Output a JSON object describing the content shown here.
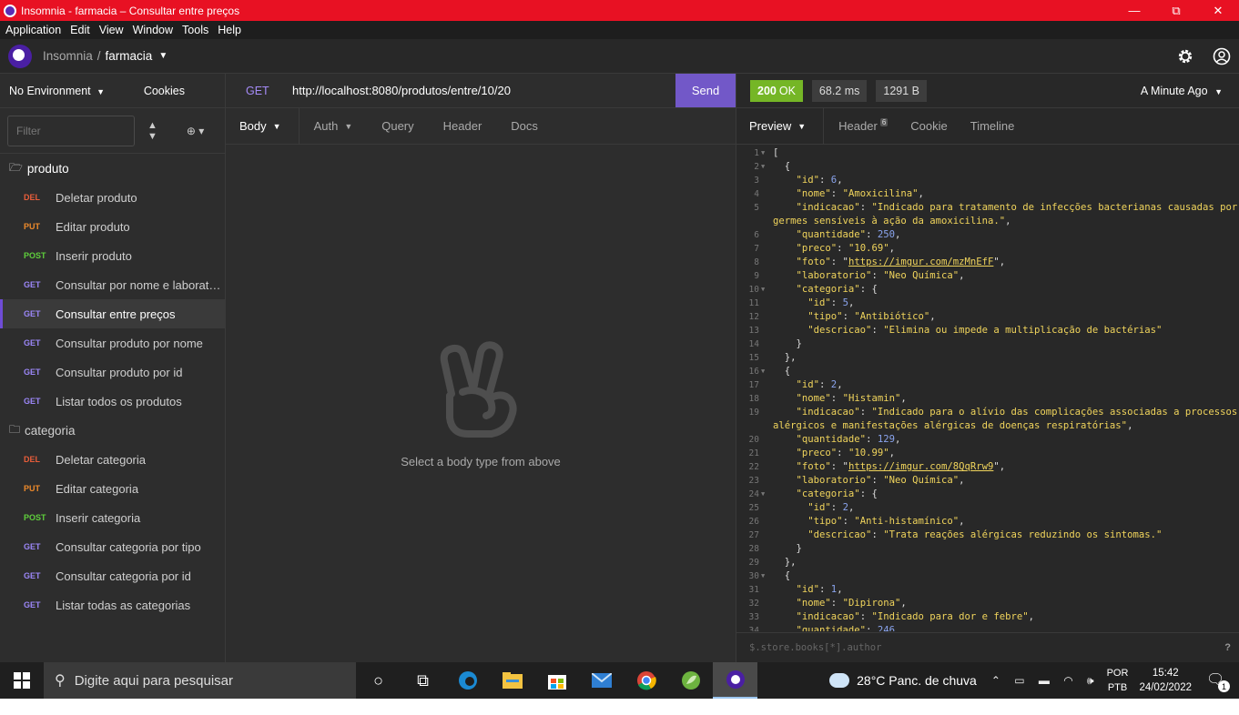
{
  "window": {
    "title": "Insomnia - farmacia – Consultar entre preços",
    "minimize": "—",
    "maximize": "⧉",
    "close": "✕"
  },
  "menu": [
    "Application",
    "Edit",
    "View",
    "Window",
    "Tools",
    "Help"
  ],
  "header": {
    "breadcrumb_app": "Insomnia",
    "breadcrumb_sep": "/",
    "breadcrumb_workspace": "farmacia"
  },
  "sidebar": {
    "environment": "No Environment",
    "cookies": "Cookies",
    "filter_placeholder": "Filter",
    "folders": [
      {
        "name": "produto",
        "requests": [
          {
            "method": "DEL",
            "label": "Deletar produto"
          },
          {
            "method": "PUT",
            "label": "Editar produto"
          },
          {
            "method": "POST",
            "label": "Inserir produto"
          },
          {
            "method": "GET",
            "label": "Consultar por nome e laboratório"
          },
          {
            "method": "GET",
            "label": "Consultar entre preços"
          },
          {
            "method": "GET",
            "label": "Consultar produto por nome"
          },
          {
            "method": "GET",
            "label": "Consultar produto por id"
          },
          {
            "method": "GET",
            "label": "Listar todos os produtos"
          }
        ]
      },
      {
        "name": "categoria",
        "requests": [
          {
            "method": "DEL",
            "label": "Deletar categoria"
          },
          {
            "method": "PUT",
            "label": "Editar categoria"
          },
          {
            "method": "POST",
            "label": "Inserir categoria"
          },
          {
            "method": "GET",
            "label": "Consultar categoria por tipo"
          },
          {
            "method": "GET",
            "label": "Consultar categoria por id"
          },
          {
            "method": "GET",
            "label": "Listar todas as categorias"
          }
        ]
      }
    ]
  },
  "request": {
    "method": "GET",
    "url": "http://localhost:8080/produtos/entre/10/20",
    "send": "Send",
    "tabs": {
      "body": "Body",
      "auth": "Auth",
      "query": "Query",
      "header": "Header",
      "docs": "Docs"
    },
    "empty_message": "Select a body type from above"
  },
  "response": {
    "status_code": "200",
    "status_text": "OK",
    "time": "68.2 ms",
    "size": "1291 B",
    "when": "A Minute Ago",
    "tabs": {
      "preview": "Preview",
      "header": "Header",
      "header_count": "6",
      "cookie": "Cookie",
      "timeline": "Timeline"
    },
    "filter_placeholder": "$.store.books[*].author",
    "help": "?"
  },
  "taskbar": {
    "search_placeholder": "Digite aqui para pesquisar",
    "weather": "28°C  Panc. de chuva",
    "lang_top": "POR",
    "lang_bottom": "PTB",
    "time": "15:42",
    "date": "24/02/2022",
    "notifications": "1"
  }
}
